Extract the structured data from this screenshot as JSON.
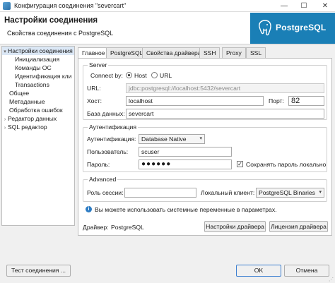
{
  "window": {
    "title": "Конфигурация соединения \"severcart\"",
    "minimize": "—",
    "maximize": "☐",
    "close": "✕"
  },
  "header": {
    "title": "Настройки соединения",
    "subtitle": "Свойства соединения с PostgreSQL",
    "logo_text": "PostgreSQL"
  },
  "tree": {
    "items": [
      {
        "label": "Настройки соединения",
        "arrow": "▾"
      },
      {
        "label": "Инициализация",
        "arrow": ""
      },
      {
        "label": "Команды ОС",
        "arrow": ""
      },
      {
        "label": "Идентификация кли",
        "arrow": ""
      },
      {
        "label": "Transactions",
        "arrow": ""
      },
      {
        "label": "Общее",
        "arrow": ""
      },
      {
        "label": "Метаданные",
        "arrow": ""
      },
      {
        "label": "Обработка ошибок",
        "arrow": ""
      },
      {
        "label": "Редактор данных",
        "arrow": "›"
      },
      {
        "label": "SQL редактор",
        "arrow": "›"
      }
    ]
  },
  "tabs": [
    "Главное",
    "PostgreSQL",
    "Свойства драйвера",
    "SSH",
    "Proxy",
    "SSL"
  ],
  "server": {
    "group_title": "Server",
    "connect_by_label": "Connect by:",
    "opt_host": "Host",
    "opt_url": "URL",
    "url_label": "URL:",
    "url_value": "jdbc:postgresql://localhost:5432/severcart",
    "host_label": "Хост:",
    "host_value": "localhost",
    "port_label": "Порт:",
    "port_value": "82",
    "db_label": "База данных:",
    "db_value": "severcart"
  },
  "auth": {
    "group_title": "Аутентификация",
    "auth_label": "Аутентификация:",
    "auth_value": "Database Native",
    "user_label": "Пользователь:",
    "user_value": "scuser",
    "pass_label": "Пароль:",
    "pass_value": "●●●●●●",
    "save_pass_label": "Сохранять пароль локально",
    "save_pass_mark": "✓"
  },
  "advanced": {
    "group_title": "Advanced",
    "role_label": "Роль сессии:",
    "role_value": "",
    "client_label": "Локальный клиент:",
    "client_value": "PostgreSQL Binaries"
  },
  "info": {
    "icon": "i",
    "text": "Вы можете использовать системные переменные в параметрах."
  },
  "driver": {
    "label": "Драйвер:",
    "value": "PostgreSQL",
    "settings_button": "Настройки драйвера",
    "license_button": "Лицензия драйвера"
  },
  "footer": {
    "test_button": "Тест соединения ...",
    "ok_button": "OK",
    "cancel_button": "Отмена"
  }
}
